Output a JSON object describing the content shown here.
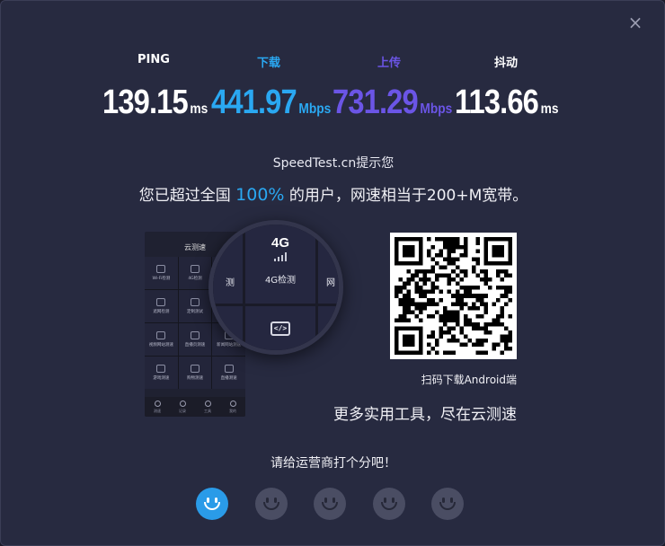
{
  "dialog": {
    "close_glyph": "×"
  },
  "metrics": [
    {
      "label": "PING",
      "value": "139.15",
      "unit": "ms",
      "color": "#ffffff",
      "label_color": "#ffffff"
    },
    {
      "label": "下载",
      "value": "441.97",
      "unit": "Mbps",
      "color": "#2aa8f2",
      "label_color": "#2aa8f2"
    },
    {
      "label": "上传",
      "value": "731.29",
      "unit": "Mbps",
      "color": "#6b55e6",
      "label_color": "#6b55e6"
    },
    {
      "label": "抖动",
      "value": "113.66",
      "unit": "ms",
      "color": "#ffffff",
      "label_color": "#ffffff"
    }
  ],
  "notice": "SpeedTest.cn提示您",
  "summary": {
    "prefix": "您已超过全国",
    "percent": "100%",
    "suffix": "的用户，网速相当于200+M宽带。"
  },
  "phone": {
    "status_left": "",
    "status_right": "",
    "title": "云测速",
    "cells": [
      {
        "icon": "wifi-icon",
        "label": "Wi-Fi检测"
      },
      {
        "icon": "4g-icon",
        "label": "4G检测"
      },
      {
        "icon": "",
        "label": ""
      },
      {
        "icon": "lock-icon",
        "label": "遮网检测"
      },
      {
        "icon": "code-icon",
        "label": "定制测试"
      },
      {
        "icon": "",
        "label": ""
      },
      {
        "icon": "play-icon",
        "label": "视频网站测速"
      },
      {
        "icon": "compass-icon",
        "label": "直播页测速"
      },
      {
        "icon": "news-icon",
        "label": "新闻网站测速"
      },
      {
        "icon": "lock-icon",
        "label": "游戏测速"
      },
      {
        "icon": "diamond-icon",
        "label": "购物测速"
      },
      {
        "icon": "video-icon",
        "label": "直播测速"
      }
    ],
    "tabs": [
      "测速",
      "记录",
      "工具",
      "我的"
    ]
  },
  "magnifier": {
    "left_text": "测",
    "center_title": "4G",
    "center_label": "4G检测",
    "right_text": "网"
  },
  "qr_caption": "扫码下载Android端",
  "tools_text": "更多实用工具，尽在云测速",
  "rating": {
    "prompt": "请给运营商打个分吧！",
    "faces": 5,
    "selected": 1
  },
  "colors": {
    "background": "#272a40",
    "accent_blue": "#2aa8f2",
    "accent_purple": "#6b55e6",
    "face_inactive": "#4a4d63",
    "face_active": "#2a9be8"
  }
}
